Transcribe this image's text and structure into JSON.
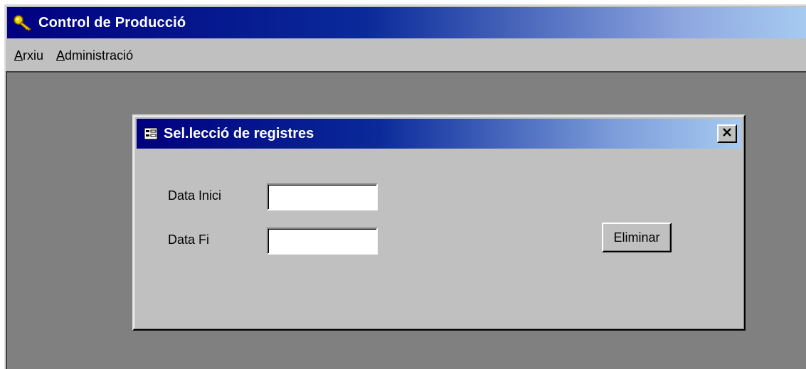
{
  "window": {
    "title": "Control de Producció",
    "icon": "key-icon"
  },
  "menu": {
    "items": [
      {
        "accel": "A",
        "rest": "rxiu"
      },
      {
        "accel": "A",
        "rest": "dministració"
      }
    ]
  },
  "dialog": {
    "title": "Sel.lecció de registres",
    "icon": "form-icon",
    "close_icon": "close-icon",
    "fields": {
      "start": {
        "label": "Data Inici",
        "value": ""
      },
      "end": {
        "label": "Data Fi",
        "value": ""
      }
    },
    "delete_label": "Eliminar"
  },
  "colors": {
    "titlebar_start": "#000080",
    "titlebar_end": "#a6caf0",
    "face": "#c0c0c0",
    "mdi_background": "#808080"
  }
}
